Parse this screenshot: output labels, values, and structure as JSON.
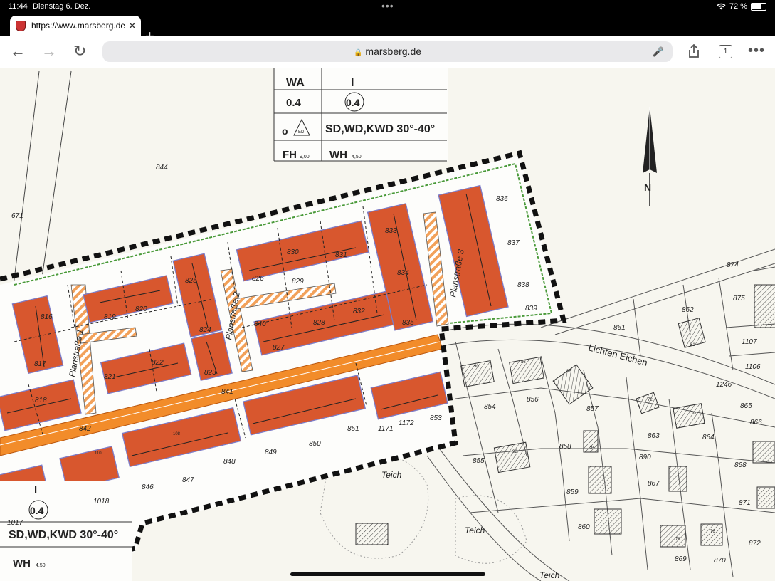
{
  "status": {
    "time": "11:44",
    "date": "Dienstag 6. Dez.",
    "battery": "72 %",
    "battery_level": 0.72
  },
  "tab": {
    "title": "https://www.marsberg.de",
    "close": "✕",
    "new": "+"
  },
  "toolbar": {
    "back": "←",
    "forward": "→",
    "reload": "↻",
    "url": "marsberg.de",
    "tab_count": "1",
    "more": "•••"
  },
  "legend_top": {
    "wa": "WA",
    "roman": "I",
    "grz": "0.4",
    "gfz": "0.4",
    "o": "o",
    "ed": "ED",
    "roof": "SD,WD,KWD 30°-40°",
    "fh": "FH",
    "fh_sub": "9,00",
    "wh": "WH",
    "wh_sub": "4,50"
  },
  "legend_bottom": {
    "roman": "I",
    "gfz": "0.4",
    "roof": "SD,WD,KWD 30°-40°",
    "wh": "WH",
    "wh_sub": "4,50"
  },
  "streets": {
    "p1": "Planstraße 1",
    "p2": "Planstraße 2",
    "p3": "Planstraße 3",
    "lichten": "Lichten Eichen",
    "teich1": "Teich",
    "teich2": "Teich",
    "teich3": "Teich"
  },
  "lots": {
    "l844": "844",
    "l671": "671",
    "l816": "816",
    "l817": "817",
    "l818": "818",
    "l819": "819",
    "l820": "820",
    "l821": "821",
    "l822": "822",
    "l823": "823",
    "l824": "824",
    "l825": "825",
    "l826": "826",
    "l827": "827",
    "l828": "828",
    "l829": "829",
    "l830": "830",
    "l831": "831",
    "l832": "832",
    "l833": "833",
    "l834": "834",
    "l835": "835",
    "l836": "836",
    "l837": "837",
    "l838": "838",
    "l839": "839",
    "l840": "840",
    "l841": "841",
    "l842": "842",
    "l846": "846",
    "l847": "847",
    "l848": "848",
    "l849": "849",
    "l850": "850",
    "l851": "851",
    "l853": "853",
    "l854": "854",
    "l855": "855",
    "l856": "856",
    "l857": "857",
    "l858": "858",
    "l859": "859",
    "l860": "860",
    "l861": "861",
    "l862": "862",
    "l863": "863",
    "l864": "864",
    "l865": "865",
    "l866": "866",
    "l867": "867",
    "l868": "868",
    "l869": "869",
    "l870": "870",
    "l871": "871",
    "l872": "872",
    "l874": "874",
    "l875": "875",
    "l890": "890",
    "l1017": "1017",
    "l1018": "1018",
    "l1106": "1106",
    "l1107": "1107",
    "l1171": "1171",
    "l1172": "1172",
    "l1246": "1246"
  },
  "house_numbers": {
    "h90": "90",
    "h88": "88",
    "h86": "86",
    "h72": "72",
    "h70": "70",
    "h92": "92",
    "h94": "94",
    "h78": "78",
    "h76": "76",
    "h51": "51",
    "h108": "108",
    "h110": "110"
  },
  "compass": {
    "label": "N"
  },
  "colors": {
    "building_zone": "#d8572e",
    "main_road": "#f28c2a",
    "hatch": "#f2a15a",
    "boundary": "#111111",
    "paper": "#f7f6ef",
    "green_line": "#4a9a3a"
  }
}
